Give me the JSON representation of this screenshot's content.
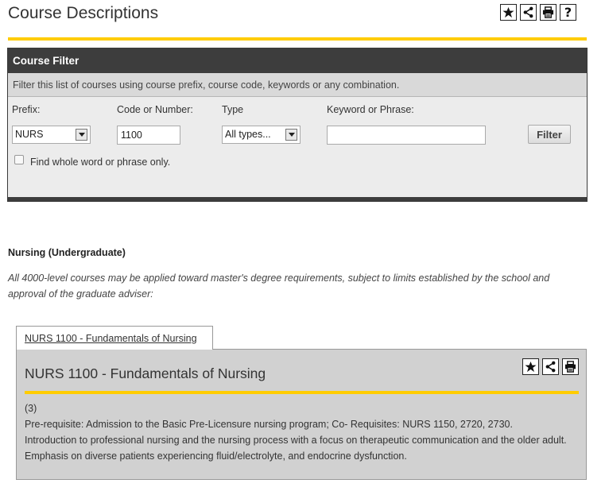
{
  "page": {
    "title": "Course Descriptions"
  },
  "toolbar": {
    "icons": [
      "star-icon",
      "share-icon",
      "print-icon",
      "help-icon"
    ],
    "help_glyph": "?"
  },
  "filter": {
    "header": "Course Filter",
    "description": "Filter this list of courses using course prefix, course code, keywords or any combination.",
    "prefix_label": "Prefix:",
    "prefix_value": "NURS",
    "code_label": "Code or Number:",
    "code_value": "1100",
    "type_label": "Type",
    "type_value": "All types...",
    "keyword_label": "Keyword or Phrase:",
    "keyword_value": "",
    "filter_button": "Filter",
    "whole_word_label": "Find whole word or phrase only.",
    "whole_word_checked": false
  },
  "section": {
    "title": "Nursing (Undergraduate)",
    "note": "All 4000-level courses may be applied toward master's degree requirements, subject to limits established by the school and approval of the graduate adviser:"
  },
  "course": {
    "tab_label": "NURS 1100 - Fundamentals of Nursing",
    "title": "NURS 1100 - Fundamentals of Nursing",
    "credits": "(3)",
    "prereq": "Pre-requisite: Admission to the Basic Pre-Licensure nursing program; Co- Requisites:  NURS 1150, 2720, 2730.",
    "description": "Introduction to professional nursing and the nursing process with a focus on therapeutic communication and the older adult. Emphasis on diverse patients experiencing fluid/electrolyte, and endocrine dysfunction."
  },
  "colors": {
    "accent": "#ffcc00",
    "header_bg": "#3d3d3d",
    "panel_bg": "#d1d1d1"
  }
}
